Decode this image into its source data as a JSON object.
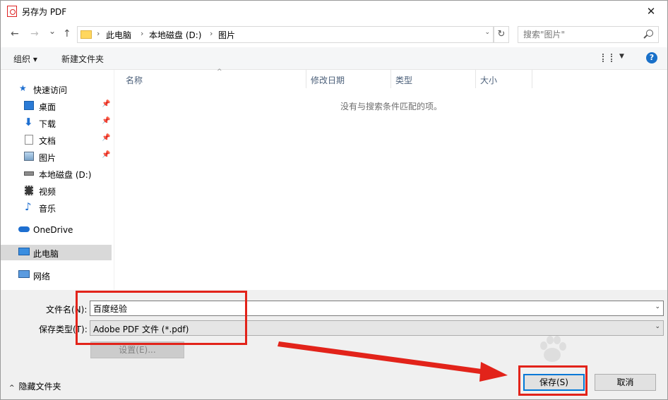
{
  "window": {
    "title": "另存为 PDF",
    "close": "✕"
  },
  "address": {
    "back": "←",
    "forward": "→",
    "recent": "⌄",
    "up": "↑",
    "crumbs": [
      "此电脑",
      "本地磁盘 (D:)",
      "图片"
    ],
    "sep": "›",
    "refresh": "↻",
    "search_placeholder": "搜索\"图片\""
  },
  "toolbar": {
    "organize": "组织 ▾",
    "new_folder": "新建文件夹",
    "help": "?"
  },
  "nav": {
    "items": [
      {
        "label": "快速访问",
        "icon": "star-icon"
      },
      {
        "label": "桌面",
        "icon": "desktop-icon",
        "pinned": true
      },
      {
        "label": "下载",
        "icon": "download-icon",
        "pinned": true
      },
      {
        "label": "文档",
        "icon": "document-icon",
        "pinned": true
      },
      {
        "label": "图片",
        "icon": "pictures-icon",
        "pinned": true
      },
      {
        "label": "本地磁盘 (D:)",
        "icon": "drive-icon"
      },
      {
        "label": "视频",
        "icon": "video-icon"
      },
      {
        "label": "音乐",
        "icon": "music-icon"
      },
      {
        "label": "OneDrive",
        "icon": "cloud-icon"
      },
      {
        "label": "此电脑",
        "icon": "computer-icon",
        "selected": true
      },
      {
        "label": "网络",
        "icon": "network-icon"
      }
    ]
  },
  "list": {
    "columns": [
      "名称",
      "修改日期",
      "类型",
      "大小"
    ],
    "sort_arrow": "^",
    "empty_message": "没有与搜索条件匹配的项。"
  },
  "form": {
    "filename_label": "文件名(N):",
    "filename_value": "百度经验",
    "filetype_label": "保存类型(T):",
    "filetype_value": "Adobe PDF 文件 (*.pdf)",
    "dropdown": "⌄",
    "settings_button": "设置(E)...",
    "hide_folders": "隐藏文件夹",
    "hide_chevron": "^",
    "save_button": "保存(S)",
    "cancel_button": "取消"
  },
  "colors": {
    "annotation": "#e2231a",
    "accent": "#0078d7"
  }
}
